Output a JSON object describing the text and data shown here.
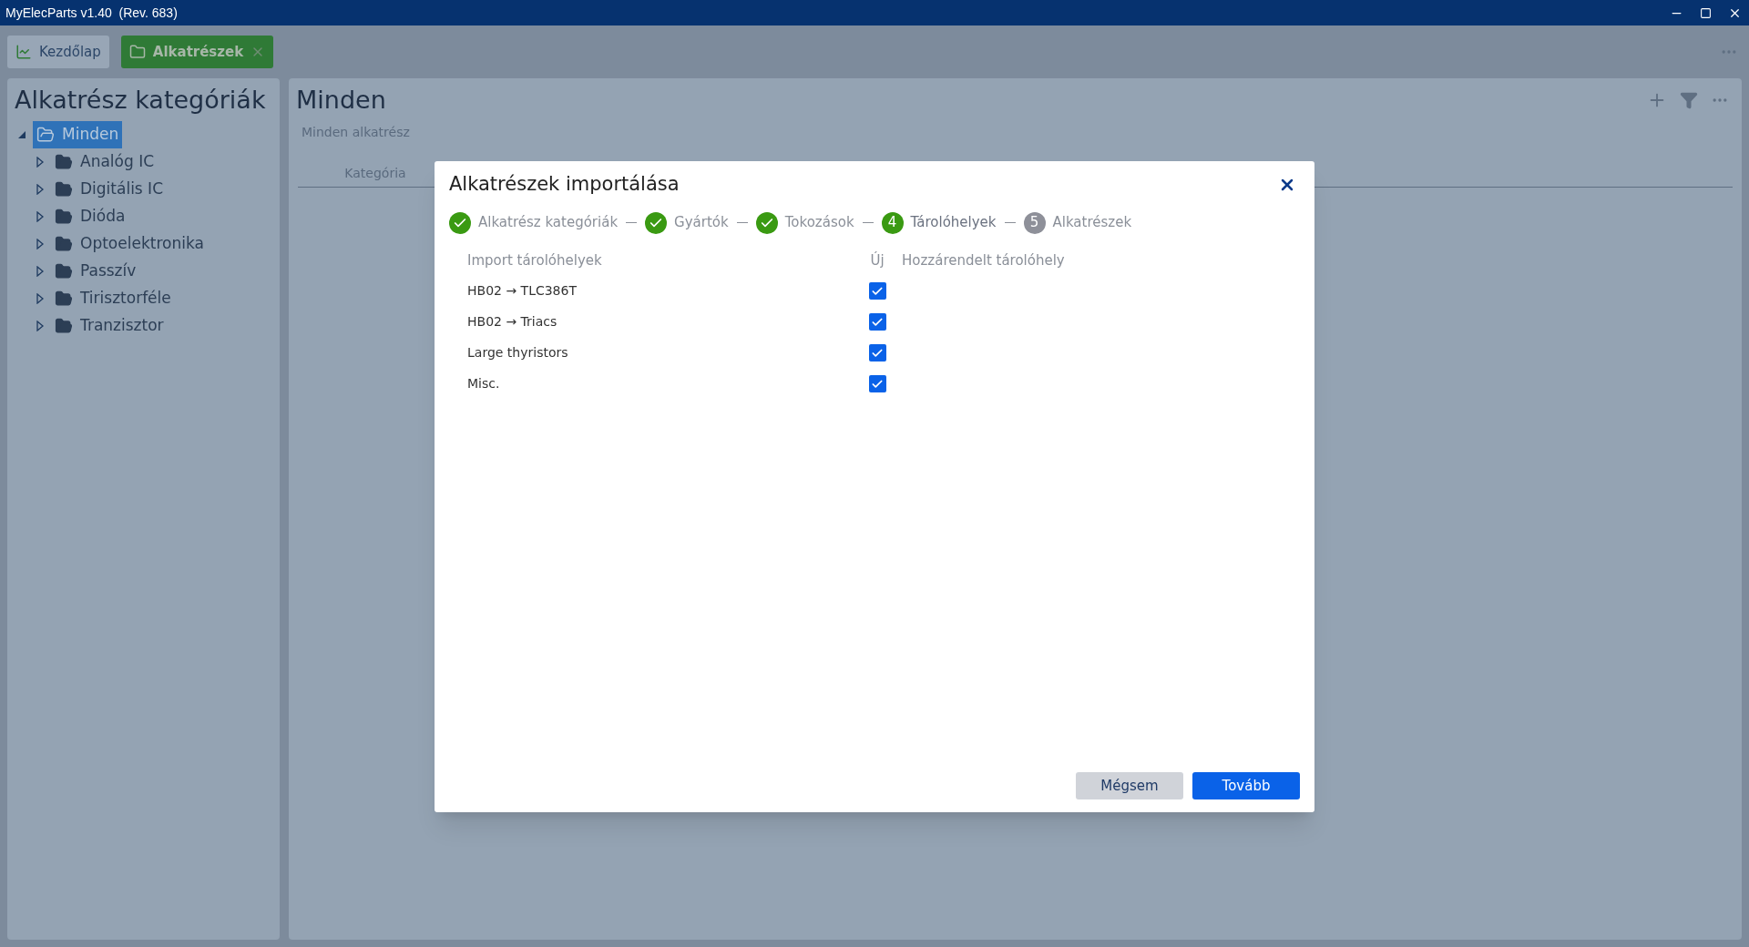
{
  "window": {
    "title": "MyElecParts v1.40  (Rev. 683)"
  },
  "tabs": [
    {
      "label": "Kezdőlap",
      "kind": "chart",
      "selected": false,
      "closable": false
    },
    {
      "label": "Alkatrészek",
      "kind": "parts",
      "selected": true,
      "closable": true
    }
  ],
  "sidebar": {
    "title": "Alkatrész kategóriák",
    "tree": [
      {
        "label": "Minden",
        "selected": true,
        "expanded": true,
        "children": [
          {
            "label": "Analóg IC",
            "selected": false,
            "expanded": false
          },
          {
            "label": "Digitális IC",
            "selected": false,
            "expanded": false
          },
          {
            "label": "Dióda",
            "selected": false,
            "expanded": false
          },
          {
            "label": "Optoelektronika",
            "selected": false,
            "expanded": false
          },
          {
            "label": "Passzív",
            "selected": false,
            "expanded": false
          },
          {
            "label": "Tirisztorféle",
            "selected": false,
            "expanded": false
          },
          {
            "label": "Tranzisztor",
            "selected": false,
            "expanded": false
          }
        ]
      }
    ]
  },
  "main": {
    "title": "Minden",
    "subtitle": "Minden alkatrész",
    "table": {
      "columns": [
        "Kategória"
      ]
    }
  },
  "dialog": {
    "title": "Alkatrészek importálása",
    "steps": [
      {
        "label": "Alkatrész kategóriák",
        "done": true,
        "selected": false
      },
      {
        "label": "Gyártók",
        "done": true,
        "selected": false
      },
      {
        "label": "Tokozások",
        "done": true,
        "selected": false
      },
      {
        "label": "Tárolóhelyek",
        "done": false,
        "selected": true,
        "number": "4"
      },
      {
        "label": "Alkatrészek",
        "done": false,
        "selected": false,
        "number": "5"
      }
    ],
    "columns": [
      "Import tárolóhelyek",
      "Új",
      "Hozzárendelt tárolóhely"
    ],
    "rows": [
      {
        "name": "HB02 → TLC386T",
        "checked": true
      },
      {
        "name": "HB02 → Triacs",
        "checked": true
      },
      {
        "name": "Large thyristors",
        "checked": true
      },
      {
        "name": "Misc.",
        "checked": true
      }
    ],
    "buttons": [
      {
        "label": "Mégsem",
        "kind": "secondary"
      },
      {
        "label": "Tovább",
        "kind": "primary"
      }
    ]
  }
}
